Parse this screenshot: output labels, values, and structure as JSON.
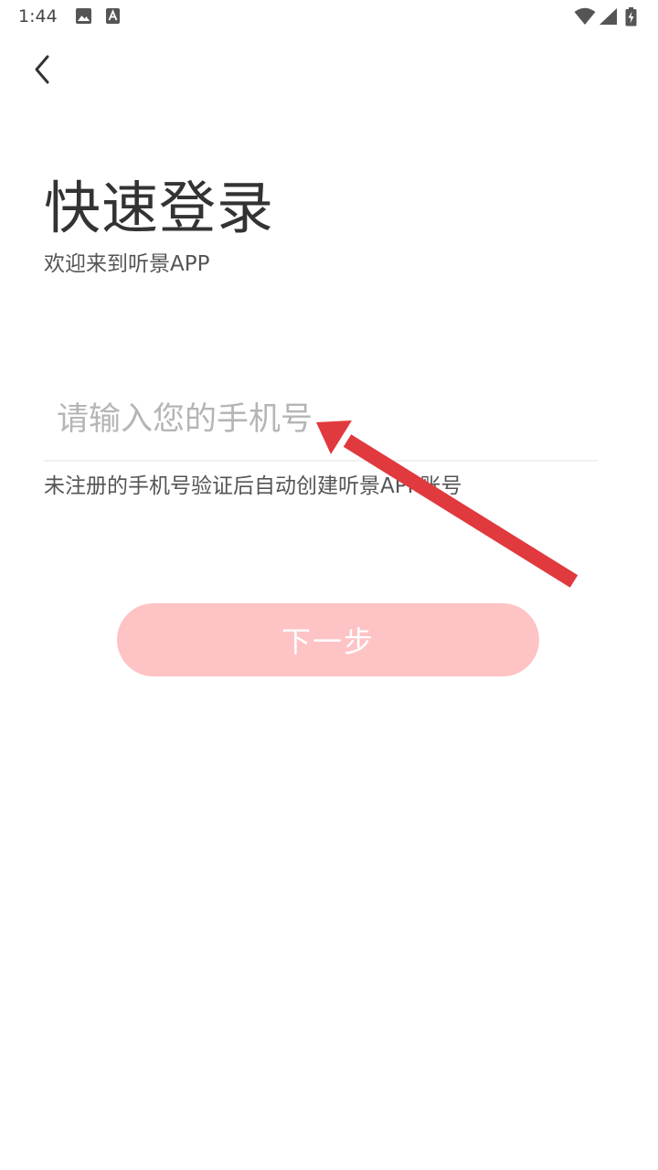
{
  "status_bar": {
    "time": "1:44",
    "icons": [
      "image-icon",
      "a-notification-icon",
      "wifi-icon",
      "signal-icon",
      "battery-charging-icon"
    ]
  },
  "header": {
    "back_icon": "chevron-left-icon"
  },
  "login": {
    "title": "快速登录",
    "subtitle": "欢迎来到听景APP",
    "phone_placeholder": "请输入您的手机号",
    "phone_value": "",
    "hint": "未注册的手机号验证后自动创建听景APP账号",
    "next_label": "下一步"
  },
  "colors": {
    "button_bg": "#fec3c4",
    "arrow": "#e0393e",
    "text_primary": "#333333",
    "placeholder": "#b5b5b5"
  }
}
